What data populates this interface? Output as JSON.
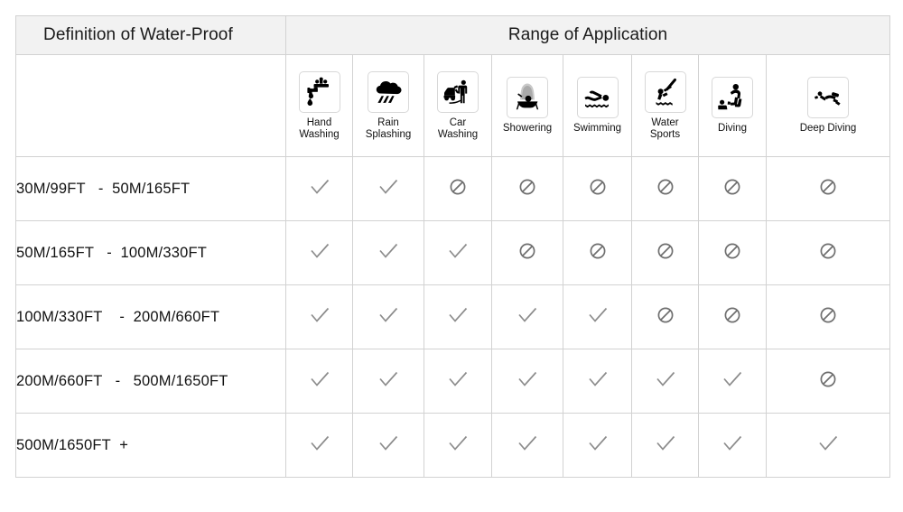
{
  "table": {
    "title_left": "Definition of Water-Proof",
    "title_right": "Range of Application",
    "columns": [
      {
        "icon": "faucet-hand-washing-icon",
        "label": "Hand\nWashing"
      },
      {
        "icon": "rain-cloud-splashing-icon",
        "label": "Rain\nSplashing"
      },
      {
        "icon": "car-washing-icon",
        "label": "Car\nWashing"
      },
      {
        "icon": "showering-icon",
        "label": "Showering"
      },
      {
        "icon": "swimming-icon",
        "label": "Swimming"
      },
      {
        "icon": "water-sports-diver-icon",
        "label": "Water\nSports"
      },
      {
        "icon": "diving-icon",
        "label": "Diving"
      },
      {
        "icon": "deep-diving-scuba-icon",
        "label": "Deep Diving"
      }
    ],
    "rows": [
      {
        "range": "30M/99FT   -  50M/165FT",
        "marks": [
          "check",
          "check",
          "ban",
          "ban",
          "ban",
          "ban",
          "ban",
          "ban"
        ]
      },
      {
        "range": "50M/165FT   -  100M/330FT",
        "marks": [
          "check",
          "check",
          "check",
          "ban",
          "ban",
          "ban",
          "ban",
          "ban"
        ]
      },
      {
        "range": "100M/330FT    -  200M/660FT",
        "marks": [
          "check",
          "check",
          "check",
          "check",
          "check",
          "ban",
          "ban",
          "ban"
        ]
      },
      {
        "range": "200M/660FT   -   500M/1650FT",
        "marks": [
          "check",
          "check",
          "check",
          "check",
          "check",
          "check",
          "check",
          "ban"
        ]
      },
      {
        "range": "500M/1650FT  +",
        "marks": [
          "check",
          "check",
          "check",
          "check",
          "check",
          "check",
          "check",
          "check"
        ]
      }
    ]
  },
  "colors": {
    "header_background": "#f2f2f2",
    "border": "#d2d2d2",
    "text": "#111111",
    "mark": "#8c8c8c",
    "icon": "#000000"
  }
}
